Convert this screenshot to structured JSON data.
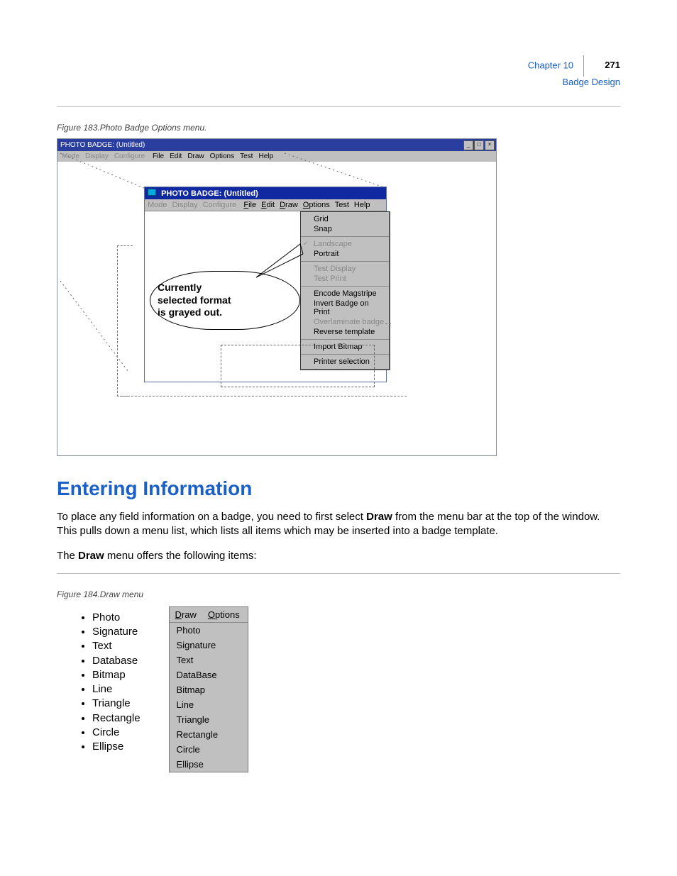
{
  "header": {
    "chapter": "Chapter 10",
    "subtitle": "Badge Design",
    "page": "271"
  },
  "fig183": {
    "caption": "Figure 183.Photo Badge Options menu.",
    "outerTitle": "PHOTO BADGE: (Untitled)",
    "outerMenu": {
      "disabled": [
        "Mode",
        "Display",
        "Configure"
      ],
      "enabled": [
        "File",
        "Edit",
        "Draw",
        "Options",
        "Test",
        "Help"
      ]
    },
    "innerTitle": "PHOTO BADGE: (Untitled)",
    "innerMenu": {
      "disabled": [
        "Mode",
        "Display",
        "Configure"
      ],
      "enabled": [
        "File",
        "Edit",
        "Draw",
        "Options",
        "Test",
        "Help"
      ]
    },
    "options": [
      {
        "items": [
          {
            "t": "Grid"
          },
          {
            "t": "Snap"
          }
        ]
      },
      {
        "items": [
          {
            "t": "Landscape",
            "dis": true,
            "chk": true
          },
          {
            "t": "Portrait"
          }
        ]
      },
      {
        "items": [
          {
            "t": "Test Display",
            "dis": true
          },
          {
            "t": "Test Print",
            "dis": true
          }
        ]
      },
      {
        "items": [
          {
            "t": "Encode Magstripe"
          },
          {
            "t": "Invert Badge on Print"
          },
          {
            "t": "Overlaminate badge",
            "dis": true
          },
          {
            "t": "Reverse template"
          }
        ]
      },
      {
        "items": [
          {
            "t": "Import Bitmap"
          }
        ]
      },
      {
        "items": [
          {
            "t": "Printer selection"
          }
        ]
      }
    ],
    "callout": {
      "l1": "Currently",
      "l2": "selected format",
      "l3": "is grayed out."
    }
  },
  "section": {
    "heading": "Entering Information",
    "p1a": "To place any field information on a badge, you need to first select ",
    "p1b": "Draw",
    "p1c": " from the menu bar at the top of the window. This pulls down a menu list, which lists all items which may be inserted into a badge template.",
    "p2a": "The ",
    "p2b": "Draw",
    "p2c": " menu offers the following items:"
  },
  "fig184": {
    "caption": "Figure 184.Draw menu",
    "bullets": [
      "Photo",
      "Signature",
      "Text",
      "Database",
      "Bitmap",
      "Line",
      "Triangle",
      "Rectangle",
      "Circle",
      "Ellipse"
    ],
    "menuHead": {
      "a": "Draw",
      "b": "Options"
    },
    "menuItems": [
      "Photo",
      "Signature",
      "Text",
      "DataBase",
      "Bitmap",
      "Line",
      "Triangle",
      "Rectangle",
      "Circle",
      "Ellipse"
    ]
  }
}
